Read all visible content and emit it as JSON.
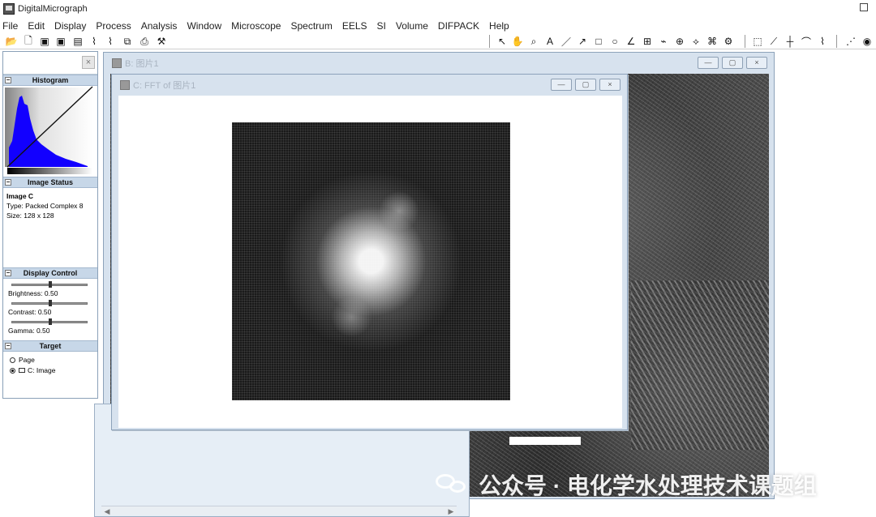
{
  "app": {
    "title": "DigitalMicrograph"
  },
  "menu": [
    "File",
    "Edit",
    "Display",
    "Process",
    "Analysis",
    "Window",
    "Microscope",
    "Spectrum",
    "EELS",
    "SI",
    "Volume",
    "DIFPACK",
    "Help"
  ],
  "toolbar_icons": [
    "open-folder-icon",
    "new-file-icon",
    "save-icon",
    "save-all-icon",
    "stack-icon",
    "line-plot-icon",
    "line-plot-alt-icon",
    "copy-icon",
    "print-icon",
    "tools-icon",
    "pointer-icon",
    "hand-icon",
    "zoom-icon",
    "text-icon",
    "line-icon",
    "arrow-icon",
    "rectangle-icon",
    "oval-icon",
    "angle-icon",
    "ruler-icon",
    "region-icon",
    "target-icon",
    "sampling-icon",
    "mask-icon",
    "measure-icon",
    "selection-rect-icon",
    "lasso-icon",
    "crosshair-icon",
    "curve-icon",
    "profile-icon",
    "dot-line-icon",
    "circle-dot-icon"
  ],
  "panel": {
    "close_label": "×",
    "sections": {
      "histogram": "Histogram",
      "image_status": "Image Status",
      "display_control": "Display Control",
      "target": "Target"
    },
    "status": {
      "image_name": "Image C",
      "type_label": "Type:",
      "type_value": "Packed Complex 8",
      "size_label": "Size:",
      "size_value": "128 x 128"
    },
    "controls": {
      "brightness_label": "Brightness: 0.50",
      "contrast_label": "Contrast: 0.50",
      "gamma_label": "Gamma: 0.50",
      "brightness_value": 0.5,
      "contrast_value": 0.5,
      "gamma_value": 0.5
    },
    "target": {
      "page_label": "Page",
      "image_label": "C: Image"
    }
  },
  "windows": {
    "b_title": "B: 图片1",
    "c_title": "C: FFT of 图片1",
    "min_label": "—",
    "restore_label": "▢",
    "close_label": "×"
  },
  "scroll": {
    "left": "◀",
    "right": "▶"
  },
  "watermark": {
    "text": "公众号 · 电化学水处理技术课题组"
  }
}
